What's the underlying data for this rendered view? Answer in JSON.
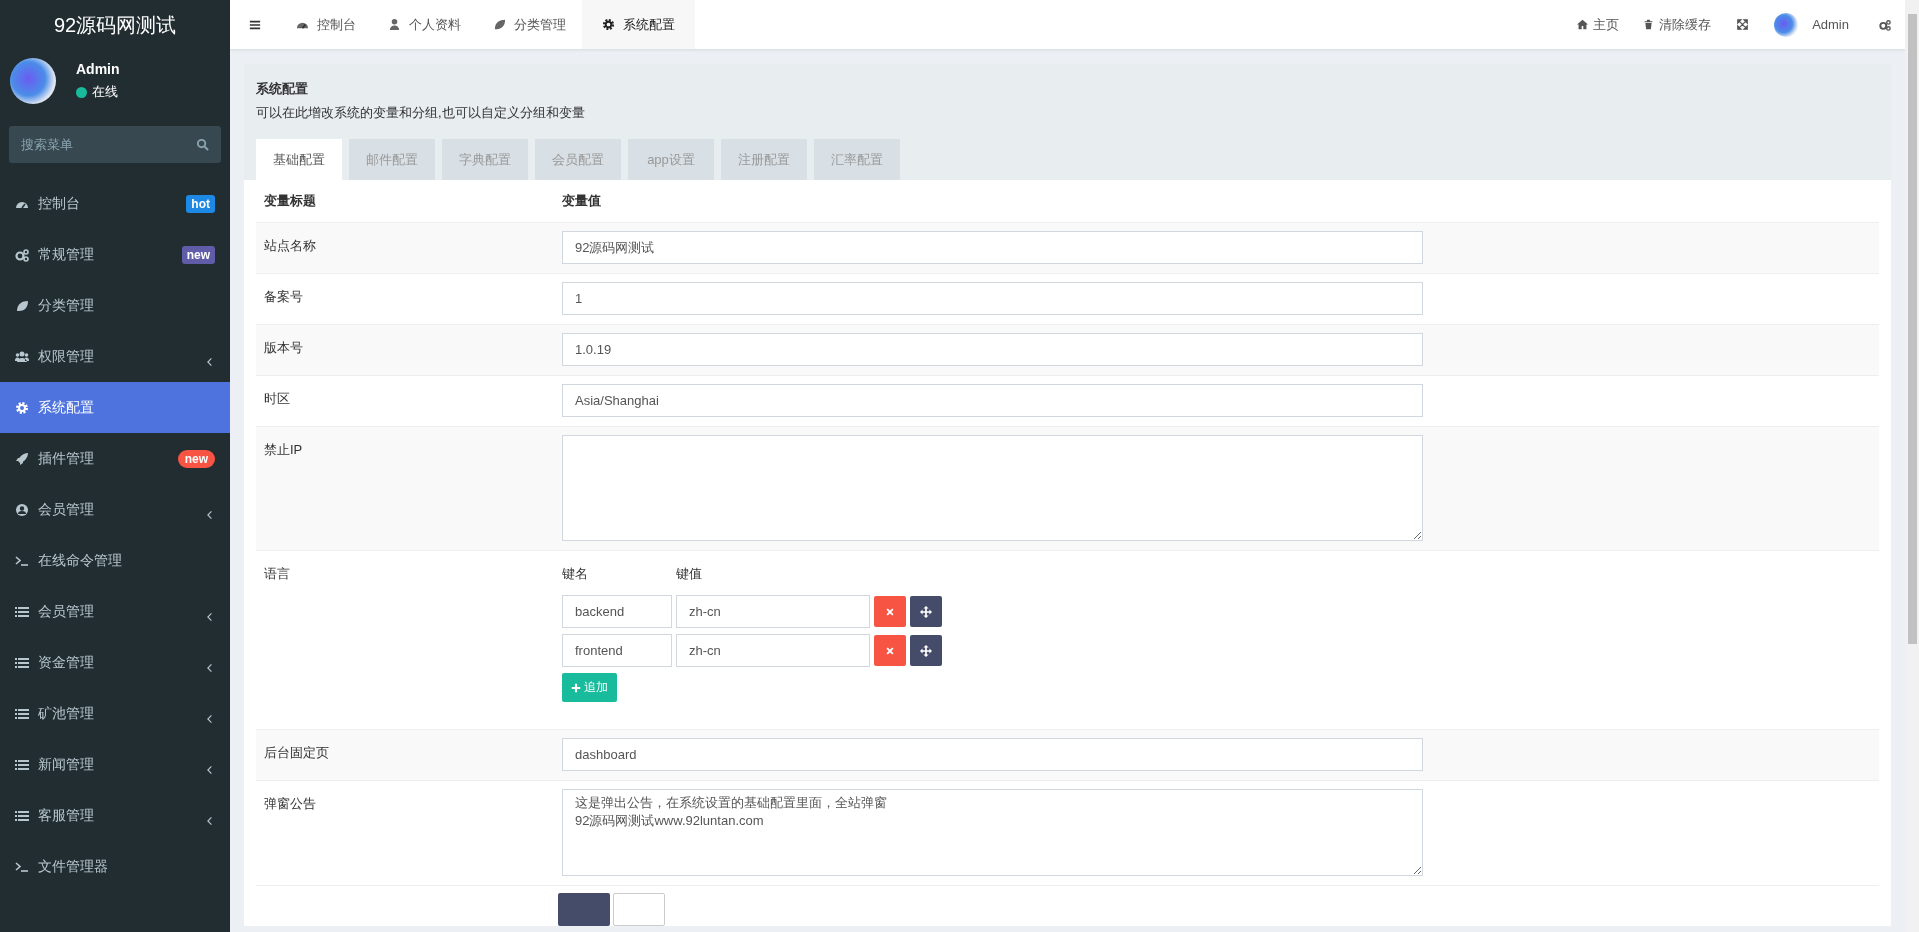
{
  "sidebar": {
    "logo": "92源码网测试",
    "user": {
      "name": "Admin",
      "status": "在线"
    },
    "search": {
      "placeholder": "搜索菜单"
    },
    "items": [
      {
        "label": "控制台",
        "selected": false,
        "submenu": false,
        "badge": {
          "text": "hot",
          "color": "#1e88e5",
          "kind": "square"
        }
      },
      {
        "label": "常规管理",
        "selected": false,
        "submenu": false,
        "badge": {
          "text": "new",
          "color": "#605ca8",
          "kind": "square"
        }
      },
      {
        "label": "分类管理",
        "selected": false,
        "submenu": false
      },
      {
        "label": "权限管理",
        "selected": false,
        "submenu": true
      },
      {
        "label": "系统配置",
        "selected": true,
        "submenu": false
      },
      {
        "label": "插件管理",
        "selected": false,
        "submenu": false,
        "badge": {
          "text": "new",
          "color": "#f75444",
          "kind": "pill"
        }
      },
      {
        "label": "会员管理",
        "selected": false,
        "submenu": true
      },
      {
        "label": "在线命令管理",
        "selected": false,
        "submenu": false
      },
      {
        "label": "会员管理",
        "selected": false,
        "submenu": true
      },
      {
        "label": "资金管理",
        "selected": false,
        "submenu": true
      },
      {
        "label": "矿池管理",
        "selected": false,
        "submenu": true
      },
      {
        "label": "新闻管理",
        "selected": false,
        "submenu": true
      },
      {
        "label": "客服管理",
        "selected": false,
        "submenu": true
      },
      {
        "label": "文件管理器",
        "selected": false,
        "submenu": false
      }
    ]
  },
  "topbar": {
    "tabs": [
      {
        "label": "控制台",
        "selected": false
      },
      {
        "label": "个人资料",
        "selected": false
      },
      {
        "label": "分类管理",
        "selected": false
      },
      {
        "label": "系统配置",
        "selected": true
      }
    ],
    "links": [
      {
        "label": "主页"
      },
      {
        "label": "清除缓存"
      }
    ],
    "user": "Admin"
  },
  "panel": {
    "title": "系统配置",
    "description": "可以在此增改系统的变量和分组,也可以自定义分组和变量",
    "tabs": [
      {
        "label": "基础配置",
        "selected": true
      },
      {
        "label": "邮件配置",
        "selected": false
      },
      {
        "label": "字典配置",
        "selected": false
      },
      {
        "label": "会员配置",
        "selected": false
      },
      {
        "label": "app设置",
        "selected": false
      },
      {
        "label": "注册配置",
        "selected": false
      },
      {
        "label": "汇率配置",
        "selected": false
      }
    ],
    "columns": [
      "变量标题",
      "变量值"
    ],
    "rows": [
      {
        "label": "站点名称",
        "kind": "input",
        "value": "92源码网测试"
      },
      {
        "label": "备案号",
        "kind": "input",
        "value": "1"
      },
      {
        "label": "版本号",
        "kind": "input",
        "value": "1.0.19"
      },
      {
        "label": "时区",
        "kind": "input",
        "value": "Asia/Shanghai"
      },
      {
        "label": "禁止IP",
        "kind": "textarea",
        "value": ""
      },
      {
        "label": "语言",
        "kind": "keyvalue",
        "key_header": "键名",
        "value_header": "键值",
        "pairs": [
          {
            "key": "backend",
            "value": "zh-cn"
          },
          {
            "key": "frontend",
            "value": "zh-cn"
          }
        ],
        "add_button": "追加"
      },
      {
        "label": "后台固定页",
        "kind": "input",
        "value": "dashboard"
      },
      {
        "label": "弹窗公告",
        "kind": "textarea",
        "value": "这是弹出公告，在系统设置的基础配置里面，全站弹窗\n92源码网测试www.92luntan.com"
      }
    ],
    "buttons": [
      {
        "kind": "primary"
      },
      {
        "kind": "default"
      }
    ]
  }
}
